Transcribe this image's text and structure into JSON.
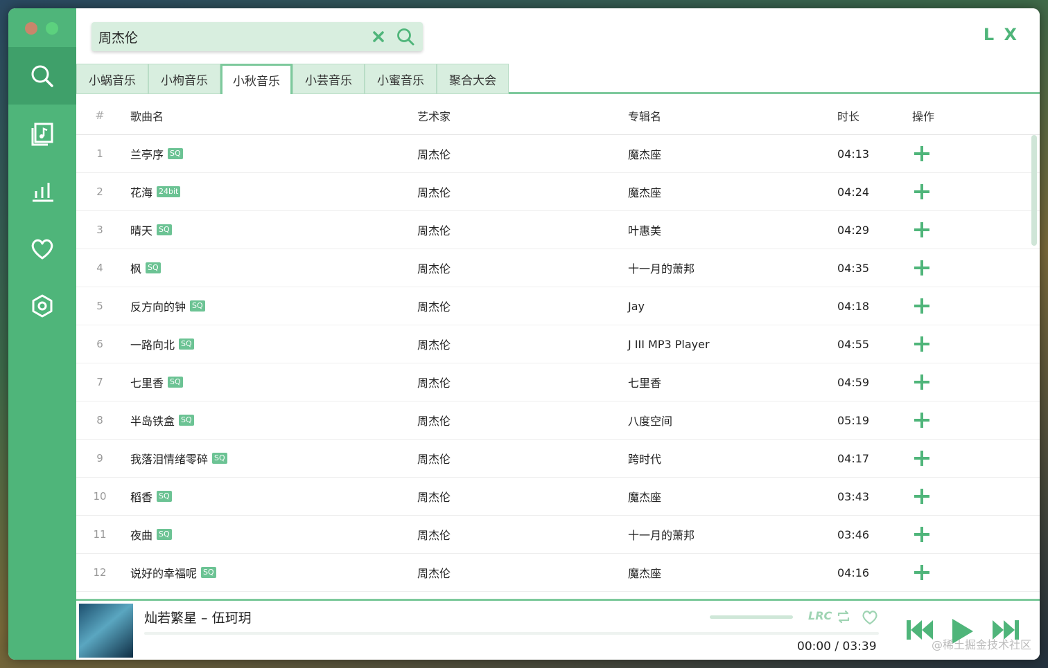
{
  "brand": "L X",
  "search": {
    "value": "周杰伦"
  },
  "sidebar": {
    "items": [
      {
        "icon": "search-icon"
      },
      {
        "icon": "music-library-icon"
      },
      {
        "icon": "chart-icon"
      },
      {
        "icon": "heart-icon"
      },
      {
        "icon": "settings-icon"
      }
    ]
  },
  "tabs": [
    "小蜗音乐",
    "小枸音乐",
    "小秋音乐",
    "小芸音乐",
    "小蜜音乐",
    "聚合大会"
  ],
  "active_tab": 2,
  "table": {
    "headers": {
      "idx": "#",
      "name": "歌曲名",
      "artist": "艺术家",
      "album": "专辑名",
      "time": "时长",
      "op": "操作"
    },
    "rows": [
      {
        "idx": "1",
        "name": "兰亭序",
        "badge": "SQ",
        "artist": "周杰伦",
        "album": "魔杰座",
        "time": "04:13"
      },
      {
        "idx": "2",
        "name": "花海",
        "badge": "24bit",
        "artist": "周杰伦",
        "album": "魔杰座",
        "time": "04:24"
      },
      {
        "idx": "3",
        "name": "晴天",
        "badge": "SQ",
        "artist": "周杰伦",
        "album": "叶惠美",
        "time": "04:29"
      },
      {
        "idx": "4",
        "name": "枫",
        "badge": "SQ",
        "artist": "周杰伦",
        "album": "十一月的萧邦",
        "time": "04:35"
      },
      {
        "idx": "5",
        "name": "反方向的钟",
        "badge": "SQ",
        "artist": "周杰伦",
        "album": "Jay",
        "time": "04:18"
      },
      {
        "idx": "6",
        "name": "一路向北",
        "badge": "SQ",
        "artist": "周杰伦",
        "album": "J III MP3 Player",
        "time": "04:55"
      },
      {
        "idx": "7",
        "name": "七里香",
        "badge": "SQ",
        "artist": "周杰伦",
        "album": "七里香",
        "time": "04:59"
      },
      {
        "idx": "8",
        "name": "半岛铁盒",
        "badge": "SQ",
        "artist": "周杰伦",
        "album": "八度空间",
        "time": "05:19"
      },
      {
        "idx": "9",
        "name": "我落泪情绪零碎",
        "badge": "SQ",
        "artist": "周杰伦",
        "album": "跨时代",
        "time": "04:17"
      },
      {
        "idx": "10",
        "name": "稻香",
        "badge": "SQ",
        "artist": "周杰伦",
        "album": "魔杰座",
        "time": "03:43"
      },
      {
        "idx": "11",
        "name": "夜曲",
        "badge": "SQ",
        "artist": "周杰伦",
        "album": "十一月的萧邦",
        "time": "03:46"
      },
      {
        "idx": "12",
        "name": "说好的幸福呢",
        "badge": "SQ",
        "artist": "周杰伦",
        "album": "魔杰座",
        "time": "04:16"
      }
    ]
  },
  "player": {
    "title": "灿若繁星 – 伍珂玥",
    "current": "00:00",
    "separator": "/",
    "duration": "03:39",
    "lrc_label": "LRC",
    "progress": 0
  },
  "watermark": "@稀土掘金技术社区",
  "colors": {
    "accent": "#4fb57a",
    "tab_bg": "#d8eedf",
    "badge": "#6cc394"
  }
}
